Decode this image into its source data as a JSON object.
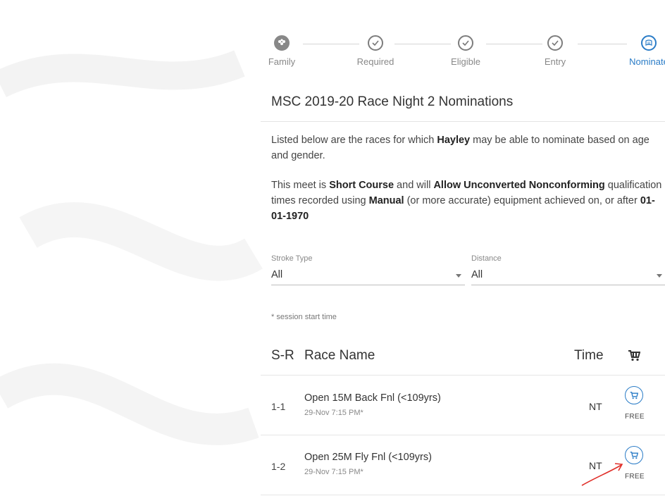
{
  "stepper": {
    "steps": [
      {
        "label": "Family",
        "icon": "family-icon",
        "state": "done"
      },
      {
        "label": "Required",
        "icon": "check-icon",
        "state": "done"
      },
      {
        "label": "Eligible",
        "icon": "check-icon",
        "state": "done"
      },
      {
        "label": "Entry",
        "icon": "check-icon",
        "state": "done"
      },
      {
        "label": "Nominate",
        "icon": "flag-icon",
        "state": "active"
      }
    ]
  },
  "page": {
    "title": "MSC 2019-20 Race Night 2 Nominations",
    "intro_1a": "Listed below are the races for which ",
    "swimmer": "Hayley",
    "intro_1b": " may be able to nominate based on age and gender.",
    "meet_a": "This meet is ",
    "course": "Short Course",
    "meet_b": " and will ",
    "conformity": "Allow Unconverted Nonconforming",
    "meet_c": " qualification times recorded using ",
    "equipment": "Manual",
    "meet_d": " (or more accurate) equipment achieved on, or after ",
    "date": "01-01-1970"
  },
  "filters": {
    "stroke": {
      "label": "Stroke Type",
      "value": "All"
    },
    "distance": {
      "label": "Distance",
      "value": "All"
    }
  },
  "note": "* session start time",
  "table": {
    "headers": {
      "sr": "S-R",
      "name": "Race Name",
      "time": "Time",
      "cart_icon": "cart-icon"
    },
    "rows": [
      {
        "sr": "1-1",
        "name": "Open 15M Back Fnl (<109yrs)",
        "session": "29-Nov 7:15 PM*",
        "time": "NT",
        "price": "FREE"
      },
      {
        "sr": "1-2",
        "name": "Open 25M Fly Fnl (<109yrs)",
        "session": "29-Nov 7:15 PM*",
        "time": "NT",
        "price": "FREE"
      }
    ]
  },
  "colors": {
    "accent": "#2a7cc7",
    "annotation_arrow": "#e0302a"
  }
}
